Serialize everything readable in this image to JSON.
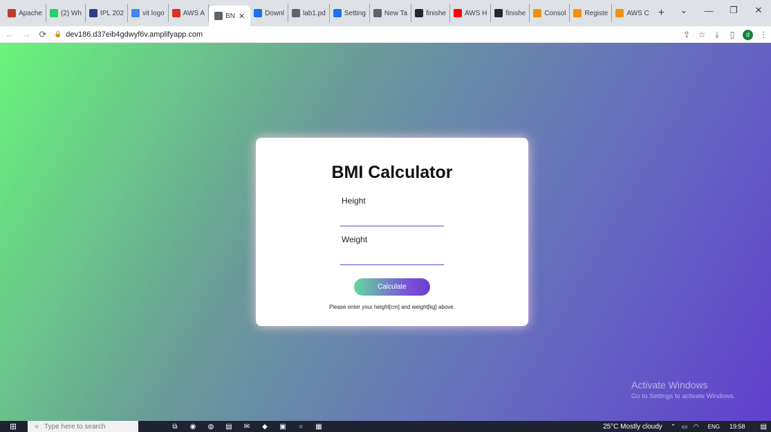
{
  "browser": {
    "tabs": [
      {
        "label": "Apache",
        "icon": "apache-icon",
        "color": "#c0392b"
      },
      {
        "label": "(2) Wh",
        "icon": "whatsapp-icon",
        "color": "#25d366"
      },
      {
        "label": "IPL 202",
        "icon": "ipl-icon",
        "color": "#2c3e8f"
      },
      {
        "label": "vit logo",
        "icon": "google-icon",
        "color": "#4285f4"
      },
      {
        "label": "AWS A",
        "icon": "aws-icon",
        "color": "#d93025"
      },
      {
        "label": "BN",
        "icon": "globe-icon",
        "color": "#5f6368",
        "active": true
      },
      {
        "label": "Downl",
        "icon": "download-icon",
        "color": "#1a73e8"
      },
      {
        "label": "lab1.pd",
        "icon": "globe-icon",
        "color": "#5f6368"
      },
      {
        "label": "Setting",
        "icon": "gear-icon",
        "color": "#1a73e8"
      },
      {
        "label": "New Ta",
        "icon": "chrome-icon",
        "color": "#5f6368"
      },
      {
        "label": "finishe",
        "icon": "github-icon",
        "color": "#24292e"
      },
      {
        "label": "AWS H",
        "icon": "youtube-icon",
        "color": "#ff0000"
      },
      {
        "label": "finishe",
        "icon": "github-icon",
        "color": "#24292e"
      },
      {
        "label": "Consol",
        "icon": "aws-cube-icon",
        "color": "#f29111"
      },
      {
        "label": "Registe",
        "icon": "aws-cube-icon",
        "color": "#f29111"
      },
      {
        "label": "AWS C",
        "icon": "aws-cube-icon",
        "color": "#f29111"
      }
    ],
    "new_tab": "+",
    "address": {
      "url": "dev186.d37eib4gdwyf6v.amplifyapp.com"
    },
    "profile_letter": "d"
  },
  "app": {
    "title": "BMI Calculator",
    "height_label": "Height",
    "weight_label": "Weight",
    "height_value": "",
    "weight_value": "",
    "button_label": "Calculate",
    "hint": "Please enter your height[cm] and weight[kg] above.",
    "colors": {
      "gradient_start": "#69f47b",
      "gradient_end": "#6140cf",
      "accent": "#6a3fc6"
    }
  },
  "watermark": {
    "title": "Activate Windows",
    "subtitle": "Go to Settings to activate Windows."
  },
  "taskbar": {
    "search_placeholder": "Type here to search",
    "weather": "25°C  Mostly cloudy",
    "language": "ENG",
    "time": "19:58"
  }
}
